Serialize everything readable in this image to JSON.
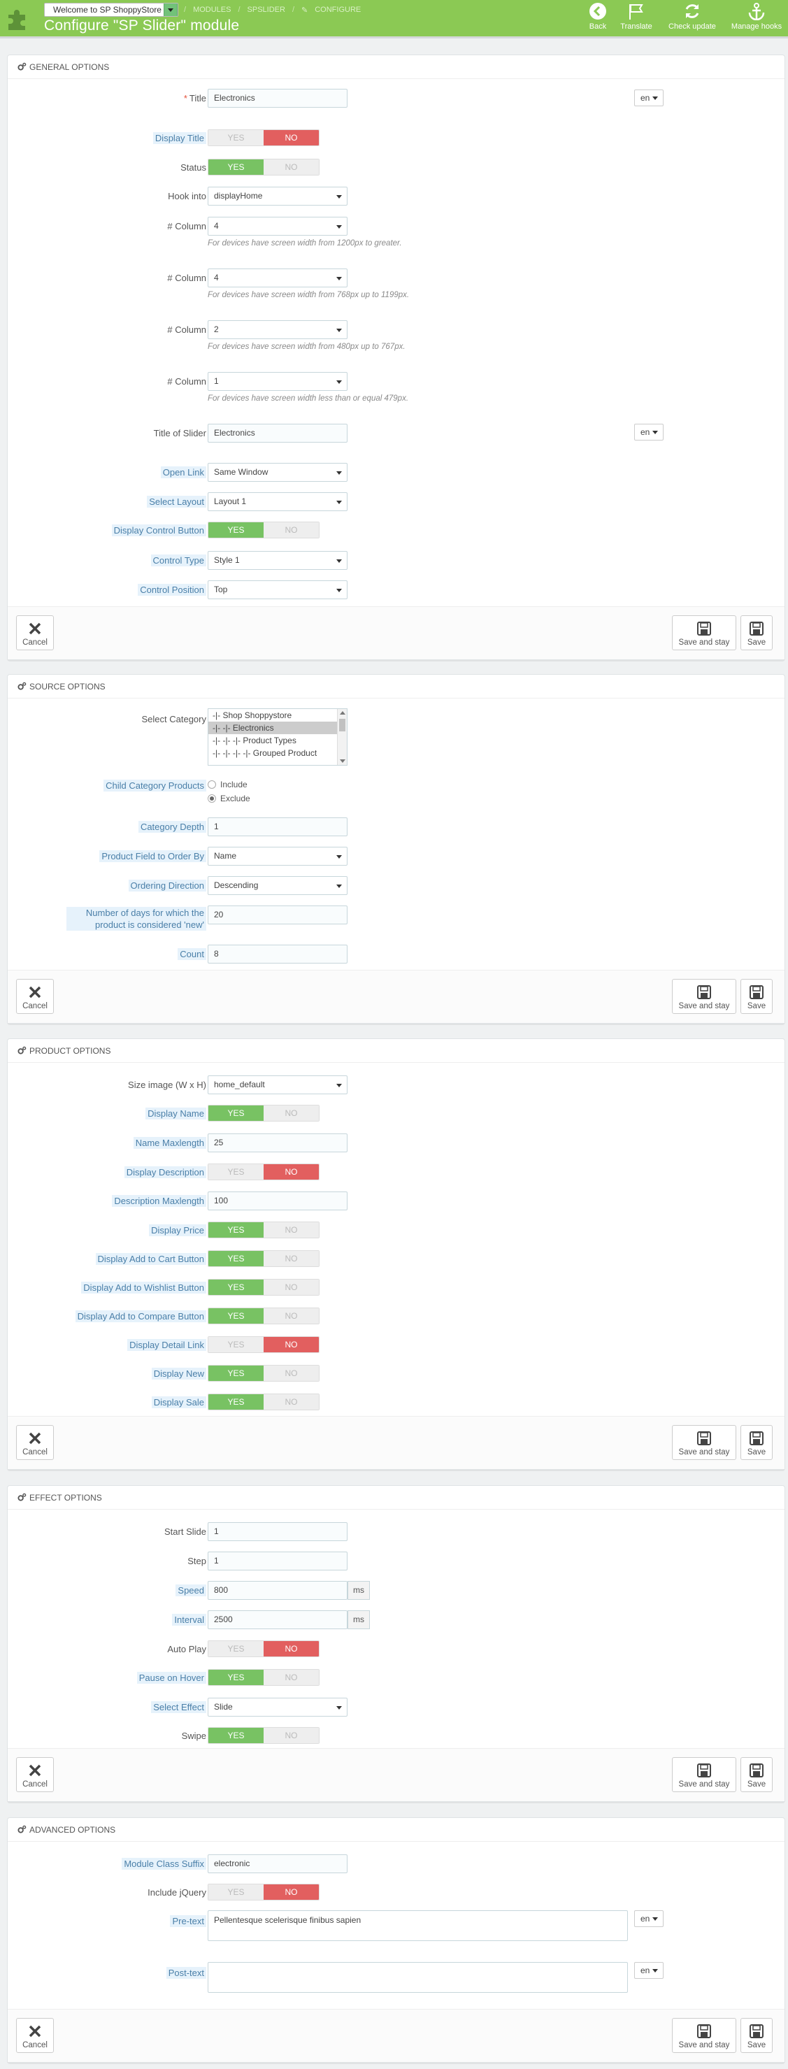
{
  "header": {
    "shop_select": "Welcome to SP ShoppyStore",
    "breadcrumb": [
      "MODULES",
      "SPSLIDER",
      "CONFIGURE"
    ],
    "title": "Configure \"SP Slider\" module",
    "toolbar": {
      "back": "Back",
      "translate": "Translate",
      "check_update": "Check update",
      "manage_hooks": "Manage hooks"
    }
  },
  "footer_buttons": {
    "cancel": "Cancel",
    "save_and_stay": "Save and stay",
    "save": "Save"
  },
  "switch_labels": {
    "yes": "YES",
    "no": "NO"
  },
  "general": {
    "heading": "GENERAL OPTIONS",
    "title_label": "Title",
    "title_value": "Electronics",
    "lang": "en",
    "display_title_label": "Display Title",
    "status_label": "Status",
    "hook_label": "Hook into",
    "hook_value": "displayHome",
    "col_label": "# Column",
    "col1_value": "4",
    "col1_help": "For devices have screen width from 1200px to greater.",
    "col2_value": "4",
    "col2_help": "For devices have screen width from 768px up to 1199px.",
    "col3_value": "2",
    "col3_help": "For devices have screen width from 480px up to 767px.",
    "col4_value": "1",
    "col4_help": "For devices have screen width less than or equal 479px.",
    "slider_title_label": "Title of Slider",
    "slider_title_value": "Electronics",
    "open_link_label": "Open Link",
    "open_link_value": "Same Window",
    "layout_label": "Select Layout",
    "layout_value": "Layout 1",
    "control_btn_label": "Display Control Button",
    "control_type_label": "Control Type",
    "control_type_value": "Style 1",
    "control_pos_label": "Control Position",
    "control_pos_value": "Top"
  },
  "source": {
    "heading": "SOURCE OPTIONS",
    "category_label": "Select Category",
    "categories": [
      "-|- Shop Shoppystore",
      "-|- -|- Electronics",
      "-|- -|- -|- Product Types",
      "-|- -|- -|- -|- Grouped Product"
    ],
    "child_label": "Child Category Products",
    "include": "Include",
    "exclude": "Exclude",
    "depth_label": "Category Depth",
    "depth_value": "1",
    "order_by_label": "Product Field to Order By",
    "order_by_value": "Name",
    "order_dir_label": "Ordering Direction",
    "order_dir_value": "Descending",
    "days_label": "Number of days for which the product is considered 'new'",
    "days_value": "20",
    "count_label": "Count",
    "count_value": "8"
  },
  "product": {
    "heading": "PRODUCT OPTIONS",
    "size_label": "Size image (W x H)",
    "size_value": "home_default",
    "display_name_label": "Display Name",
    "name_max_label": "Name Maxlength",
    "name_max_value": "25",
    "display_desc_label": "Display Description",
    "desc_max_label": "Description Maxlength",
    "desc_max_value": "100",
    "display_price_label": "Display Price",
    "cart_label": "Display Add to Cart Button",
    "wishlist_label": "Display Add to Wishlist Button",
    "compare_label": "Display Add to Compare Button",
    "detail_label": "Display Detail Link",
    "new_label": "Display New",
    "sale_label": "Display Sale"
  },
  "effect": {
    "heading": "EFFECT OPTIONS",
    "start_label": "Start Slide",
    "start_value": "1",
    "step_label": "Step",
    "step_value": "1",
    "speed_label": "Speed",
    "speed_value": "800",
    "interval_label": "Interval",
    "interval_value": "2500",
    "ms": "ms",
    "autoplay_label": "Auto Play",
    "pause_label": "Pause on Hover",
    "effect_label": "Select Effect",
    "effect_value": "Slide",
    "swipe_label": "Swipe"
  },
  "advanced": {
    "heading": "ADVANCED OPTIONS",
    "suffix_label": "Module Class Suffix",
    "suffix_value": "electronic",
    "jquery_label": "Include jQuery",
    "pretext_label": "Pre-text",
    "pretext_value": "Pellentesque scelerisque finibus sapien",
    "posttext_label": "Post-text",
    "posttext_value": "",
    "lang": "en"
  },
  "colors": {
    "header_green": "#8bc954",
    "yes_green": "#78c263",
    "no_red": "#e25f5f"
  }
}
